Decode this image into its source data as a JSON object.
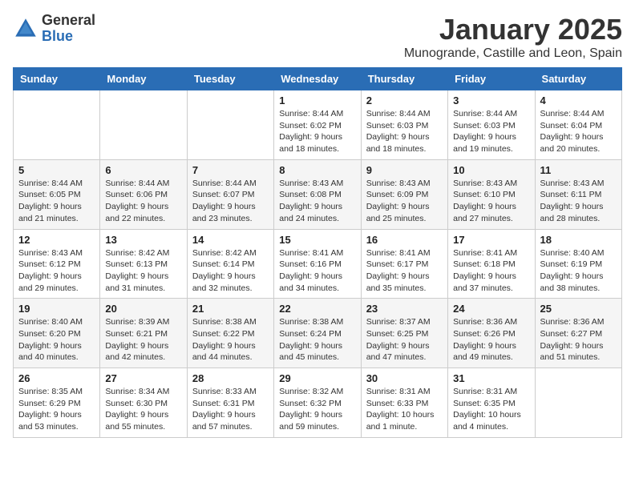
{
  "header": {
    "logo_general": "General",
    "logo_blue": "Blue",
    "month_title": "January 2025",
    "location": "Munogrande, Castille and Leon, Spain"
  },
  "weekdays": [
    "Sunday",
    "Monday",
    "Tuesday",
    "Wednesday",
    "Thursday",
    "Friday",
    "Saturday"
  ],
  "weeks": [
    [
      {
        "day": "",
        "info": ""
      },
      {
        "day": "",
        "info": ""
      },
      {
        "day": "",
        "info": ""
      },
      {
        "day": "1",
        "info": "Sunrise: 8:44 AM\nSunset: 6:02 PM\nDaylight: 9 hours\nand 18 minutes."
      },
      {
        "day": "2",
        "info": "Sunrise: 8:44 AM\nSunset: 6:03 PM\nDaylight: 9 hours\nand 18 minutes."
      },
      {
        "day": "3",
        "info": "Sunrise: 8:44 AM\nSunset: 6:03 PM\nDaylight: 9 hours\nand 19 minutes."
      },
      {
        "day": "4",
        "info": "Sunrise: 8:44 AM\nSunset: 6:04 PM\nDaylight: 9 hours\nand 20 minutes."
      }
    ],
    [
      {
        "day": "5",
        "info": "Sunrise: 8:44 AM\nSunset: 6:05 PM\nDaylight: 9 hours\nand 21 minutes."
      },
      {
        "day": "6",
        "info": "Sunrise: 8:44 AM\nSunset: 6:06 PM\nDaylight: 9 hours\nand 22 minutes."
      },
      {
        "day": "7",
        "info": "Sunrise: 8:44 AM\nSunset: 6:07 PM\nDaylight: 9 hours\nand 23 minutes."
      },
      {
        "day": "8",
        "info": "Sunrise: 8:43 AM\nSunset: 6:08 PM\nDaylight: 9 hours\nand 24 minutes."
      },
      {
        "day": "9",
        "info": "Sunrise: 8:43 AM\nSunset: 6:09 PM\nDaylight: 9 hours\nand 25 minutes."
      },
      {
        "day": "10",
        "info": "Sunrise: 8:43 AM\nSunset: 6:10 PM\nDaylight: 9 hours\nand 27 minutes."
      },
      {
        "day": "11",
        "info": "Sunrise: 8:43 AM\nSunset: 6:11 PM\nDaylight: 9 hours\nand 28 minutes."
      }
    ],
    [
      {
        "day": "12",
        "info": "Sunrise: 8:43 AM\nSunset: 6:12 PM\nDaylight: 9 hours\nand 29 minutes."
      },
      {
        "day": "13",
        "info": "Sunrise: 8:42 AM\nSunset: 6:13 PM\nDaylight: 9 hours\nand 31 minutes."
      },
      {
        "day": "14",
        "info": "Sunrise: 8:42 AM\nSunset: 6:14 PM\nDaylight: 9 hours\nand 32 minutes."
      },
      {
        "day": "15",
        "info": "Sunrise: 8:41 AM\nSunset: 6:16 PM\nDaylight: 9 hours\nand 34 minutes."
      },
      {
        "day": "16",
        "info": "Sunrise: 8:41 AM\nSunset: 6:17 PM\nDaylight: 9 hours\nand 35 minutes."
      },
      {
        "day": "17",
        "info": "Sunrise: 8:41 AM\nSunset: 6:18 PM\nDaylight: 9 hours\nand 37 minutes."
      },
      {
        "day": "18",
        "info": "Sunrise: 8:40 AM\nSunset: 6:19 PM\nDaylight: 9 hours\nand 38 minutes."
      }
    ],
    [
      {
        "day": "19",
        "info": "Sunrise: 8:40 AM\nSunset: 6:20 PM\nDaylight: 9 hours\nand 40 minutes."
      },
      {
        "day": "20",
        "info": "Sunrise: 8:39 AM\nSunset: 6:21 PM\nDaylight: 9 hours\nand 42 minutes."
      },
      {
        "day": "21",
        "info": "Sunrise: 8:38 AM\nSunset: 6:22 PM\nDaylight: 9 hours\nand 44 minutes."
      },
      {
        "day": "22",
        "info": "Sunrise: 8:38 AM\nSunset: 6:24 PM\nDaylight: 9 hours\nand 45 minutes."
      },
      {
        "day": "23",
        "info": "Sunrise: 8:37 AM\nSunset: 6:25 PM\nDaylight: 9 hours\nand 47 minutes."
      },
      {
        "day": "24",
        "info": "Sunrise: 8:36 AM\nSunset: 6:26 PM\nDaylight: 9 hours\nand 49 minutes."
      },
      {
        "day": "25",
        "info": "Sunrise: 8:36 AM\nSunset: 6:27 PM\nDaylight: 9 hours\nand 51 minutes."
      }
    ],
    [
      {
        "day": "26",
        "info": "Sunrise: 8:35 AM\nSunset: 6:29 PM\nDaylight: 9 hours\nand 53 minutes."
      },
      {
        "day": "27",
        "info": "Sunrise: 8:34 AM\nSunset: 6:30 PM\nDaylight: 9 hours\nand 55 minutes."
      },
      {
        "day": "28",
        "info": "Sunrise: 8:33 AM\nSunset: 6:31 PM\nDaylight: 9 hours\nand 57 minutes."
      },
      {
        "day": "29",
        "info": "Sunrise: 8:32 AM\nSunset: 6:32 PM\nDaylight: 9 hours\nand 59 minutes."
      },
      {
        "day": "30",
        "info": "Sunrise: 8:31 AM\nSunset: 6:33 PM\nDaylight: 10 hours\nand 1 minute."
      },
      {
        "day": "31",
        "info": "Sunrise: 8:31 AM\nSunset: 6:35 PM\nDaylight: 10 hours\nand 4 minutes."
      },
      {
        "day": "",
        "info": ""
      }
    ]
  ]
}
